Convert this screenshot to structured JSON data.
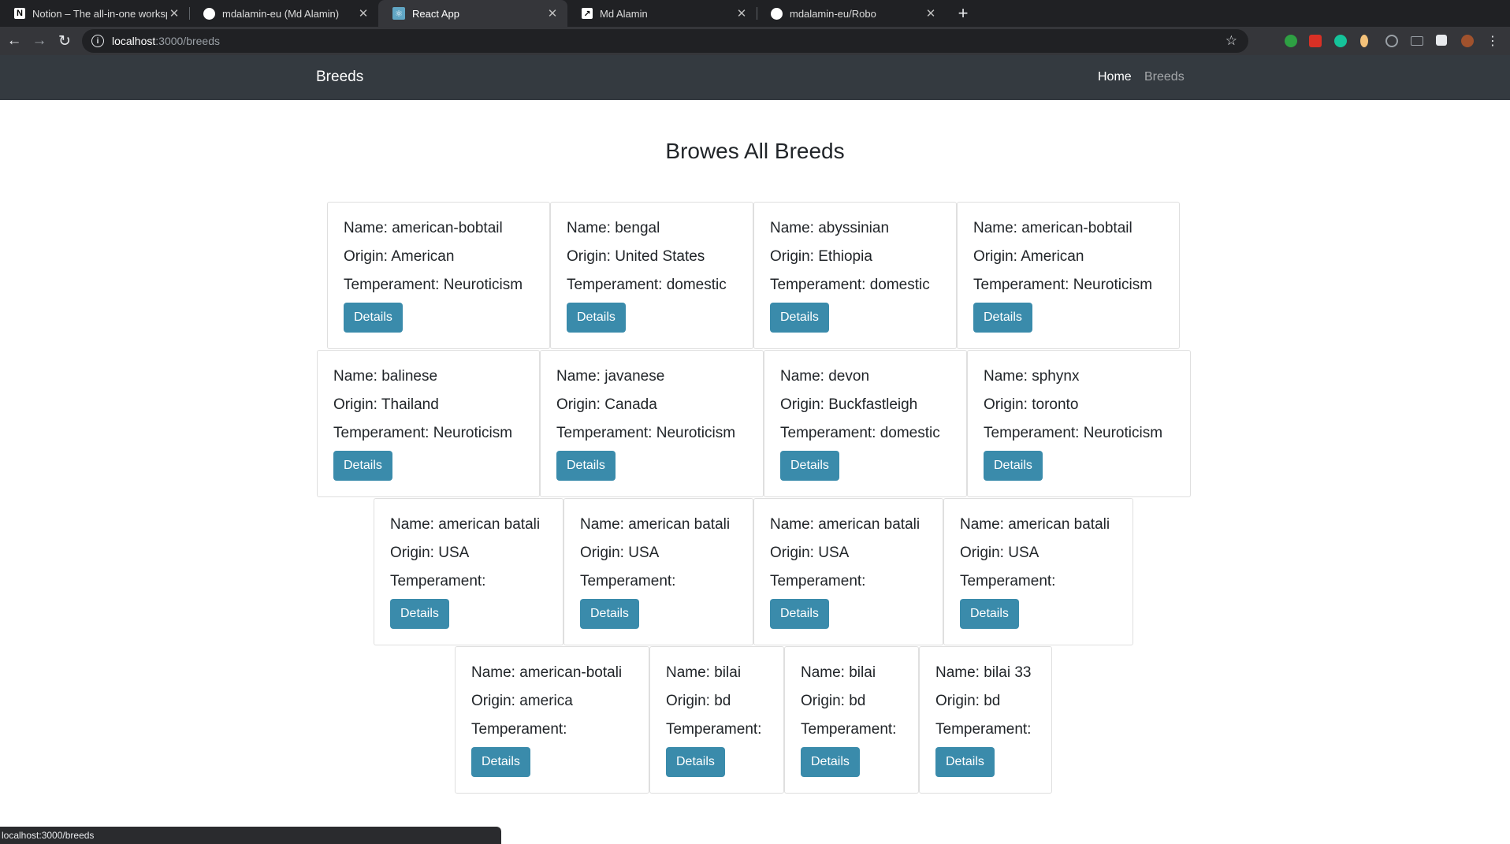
{
  "browser": {
    "tabs": [
      {
        "title": "Notion – The all-in-one worksp",
        "icon": "notion-icon"
      },
      {
        "title": "mdalamin-eu (Md Alamin)",
        "icon": "github-icon"
      },
      {
        "title": "React App",
        "icon": "react-icon"
      },
      {
        "title": "Md Alamin",
        "icon": "profile-icon"
      },
      {
        "title": "mdalamin-eu/Robo",
        "icon": "github-icon"
      }
    ],
    "url_host": "localhost",
    "url_path": ":3000/breeds",
    "status_url": "localhost:3000/breeds"
  },
  "navbar": {
    "brand": "Breeds",
    "links": [
      "Home",
      "Breeds"
    ]
  },
  "main": {
    "heading": "Browes All Breeds"
  },
  "button_label": "Details",
  "breeds": [
    {
      "name": "Name: american-bobtail",
      "origin": "Origin: American",
      "temperament": "Temperament: Neuroticism"
    },
    {
      "name": "Name: bengal",
      "origin": "Origin: United States",
      "temperament": "Temperament: domestic"
    },
    {
      "name": "Name: abyssinian",
      "origin": "Origin: Ethiopia",
      "temperament": "Temperament: domestic"
    },
    {
      "name": "Name: american-bobtail",
      "origin": "Origin: American",
      "temperament": "Temperament: Neuroticism"
    },
    {
      "name": "Name: balinese",
      "origin": "Origin: Thailand",
      "temperament": "Temperament: Neuroticism"
    },
    {
      "name": "Name: javanese",
      "origin": "Origin: Canada",
      "temperament": "Temperament: Neuroticism"
    },
    {
      "name": "Name: devon",
      "origin": "Origin: Buckfastleigh",
      "temperament": "Temperament: domestic"
    },
    {
      "name": "Name: sphynx",
      "origin": "Origin: toronto",
      "temperament": "Temperament: Neuroticism"
    },
    {
      "name": "Name: american batali",
      "origin": "Origin: USA",
      "temperament": "Temperament:"
    },
    {
      "name": "Name: american batali",
      "origin": "Origin: USA",
      "temperament": "Temperament:"
    },
    {
      "name": "Name: american batali",
      "origin": "Origin: USA",
      "temperament": "Temperament:"
    },
    {
      "name": "Name: american batali",
      "origin": "Origin: USA",
      "temperament": "Temperament:"
    },
    {
      "name": "Name: american-botali",
      "origin": "Origin: america",
      "temperament": "Temperament:"
    },
    {
      "name": "Name: bilai",
      "origin": "Origin: bd",
      "temperament": "Temperament:"
    },
    {
      "name": "Name: bilai",
      "origin": "Origin: bd",
      "temperament": "Temperament:"
    },
    {
      "name": "Name: bilai 33",
      "origin": "Origin: bd",
      "temperament": "Temperament:"
    }
  ],
  "colors": {
    "navbar": "#343a40",
    "button": "#3a8bab"
  }
}
